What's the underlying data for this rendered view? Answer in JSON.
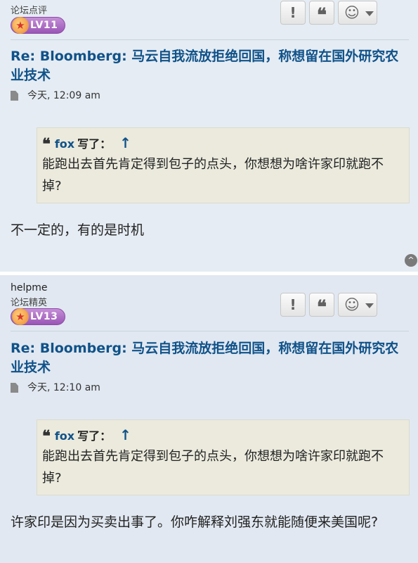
{
  "posts": [
    {
      "rank": "论坛点评",
      "level": "LV11",
      "title": "Re: Bloomberg: 马云自我流放拒绝回国，称想留在国外研究农业技术",
      "time": "今天, 12:09 am",
      "quote": {
        "author": "fox",
        "wrote": "写了：",
        "arrow": "↑",
        "text": "能跑出去首先肯定得到包子的点头，你想想为啥许家印就跑不掉?"
      },
      "content": "不一定的，有的是时机"
    },
    {
      "username": "helpme",
      "rank": "论坛精英",
      "level": "LV13",
      "title": "Re: Bloomberg: 马云自我流放拒绝回国，称想留在国外研究农业技术",
      "time": "今天, 12:10 am",
      "quote": {
        "author": "fox",
        "wrote": "写了：",
        "arrow": "↑",
        "text": "能跑出去首先肯定得到包子的点头，你想想为啥许家印就跑不掉?"
      },
      "content": "许家印是因为买卖出事了。你咋解释刘强东就能随便来美国呢?"
    }
  ],
  "icons": {
    "report": "!",
    "quote": "❝",
    "react": "☺",
    "rank_star": "★",
    "back_to_top": "^"
  },
  "colors": {
    "title_link": "#105289",
    "post_bg": "#e5ecf3",
    "quote_bg": "#ebeadd"
  }
}
